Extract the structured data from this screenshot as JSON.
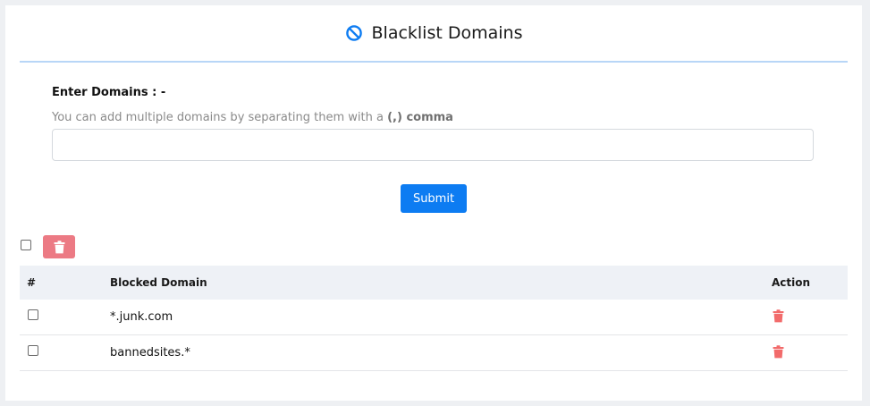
{
  "header": {
    "title": "Blacklist Domains",
    "icon": "ban-icon",
    "icon_color": "#0d7cf2"
  },
  "form": {
    "label": "Enter Domains : -",
    "help_prefix": "You can add multiple domains by separating them with a",
    "help_bold": "(,) comma",
    "input_value": "",
    "input_placeholder": "",
    "submit_label": "Submit",
    "submit_color": "#0d7cf2"
  },
  "bulk": {
    "delete_icon": "trash-icon",
    "delete_color": "#ec7a84"
  },
  "table": {
    "headers": {
      "num": "#",
      "domain": "Blocked Domain",
      "action": "Action"
    },
    "rows": [
      {
        "domain": "*.junk.com",
        "action_icon": "trash-icon"
      },
      {
        "domain": "bannedsites.*",
        "action_icon": "trash-icon"
      }
    ],
    "action_color": "#f26b6b"
  }
}
